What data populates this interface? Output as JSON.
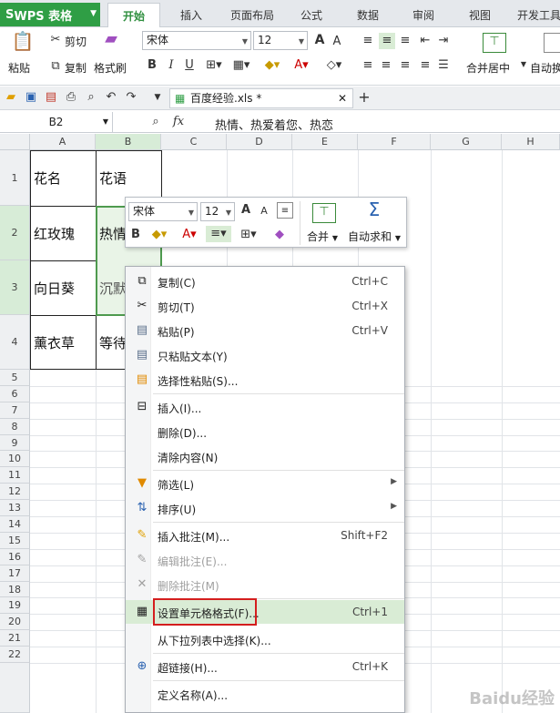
{
  "app": {
    "name": "WPS 表格"
  },
  "tabs": [
    "开始",
    "插入",
    "页面布局",
    "公式",
    "数据",
    "审阅",
    "视图",
    "开发工具"
  ],
  "ribbon": {
    "paste": "粘贴",
    "cut": "剪切",
    "copy": "复制",
    "format_painter": "格式刷",
    "font_name": "宋体",
    "font_size": "12",
    "merge_center": "合并居中",
    "auto_wrap": "自动换行"
  },
  "document": {
    "tab_title": "百度经验.xls *"
  },
  "formula_bar": {
    "cell_ref": "B2",
    "fx": "fx",
    "content": "热情、热爱着您、热恋"
  },
  "columns": [
    "A",
    "B",
    "C",
    "D",
    "E",
    "F",
    "G",
    "H"
  ],
  "rows": [
    "1",
    "2",
    "3",
    "4",
    "5",
    "6",
    "7",
    "8",
    "9",
    "10",
    "11",
    "12",
    "13",
    "14",
    "15",
    "16",
    "17",
    "18",
    "19",
    "20",
    "21",
    "22"
  ],
  "cells": {
    "A1": "花名",
    "B1": "花语",
    "A2": "红玫瑰",
    "B2": "热情",
    "A3": "向日葵",
    "B3": "沉默",
    "A4": "薰衣草",
    "B4": "等待"
  },
  "mini_toolbar": {
    "font_name": "宋体",
    "font_size": "12",
    "merge": "合并",
    "autosum": "自动求和"
  },
  "context_menu": [
    {
      "label": "复制(C)",
      "shortcut": "Ctrl+C",
      "icon": "copy-icon"
    },
    {
      "label": "剪切(T)",
      "shortcut": "Ctrl+X",
      "icon": "scissors-icon"
    },
    {
      "label": "粘贴(P)",
      "shortcut": "Ctrl+V",
      "icon": "paste-icon"
    },
    {
      "label": "只粘贴文本(Y)",
      "shortcut": "",
      "icon": "paste-text-icon"
    },
    {
      "label": "选择性粘贴(S)...",
      "shortcut": "",
      "icon": "paste-special-icon"
    },
    {
      "label": "插入(I)...",
      "shortcut": "",
      "icon": "insert-icon"
    },
    {
      "label": "删除(D)...",
      "shortcut": "",
      "icon": ""
    },
    {
      "label": "清除内容(N)",
      "shortcut": "",
      "icon": ""
    },
    {
      "label": "筛选(L)",
      "shortcut": "",
      "icon": "filter-icon"
    },
    {
      "label": "排序(U)",
      "shortcut": "",
      "icon": "sort-icon"
    },
    {
      "label": "插入批注(M)...",
      "shortcut": "Shift+F2",
      "icon": "comment-icon"
    },
    {
      "label": "编辑批注(E)...",
      "shortcut": "",
      "icon": "edit-comment-icon"
    },
    {
      "label": "删除批注(M)",
      "shortcut": "",
      "icon": "delete-comment-icon"
    },
    {
      "label": "设置单元格格式(F)...",
      "shortcut": "Ctrl+1",
      "icon": "format-cells-icon"
    },
    {
      "label": "从下拉列表中选择(K)...",
      "shortcut": "",
      "icon": ""
    },
    {
      "label": "超链接(H)...",
      "shortcut": "Ctrl+K",
      "icon": "hyperlink-icon"
    },
    {
      "label": "定义名称(A)...",
      "shortcut": "",
      "icon": ""
    }
  ],
  "watermark": "Baidu经验"
}
